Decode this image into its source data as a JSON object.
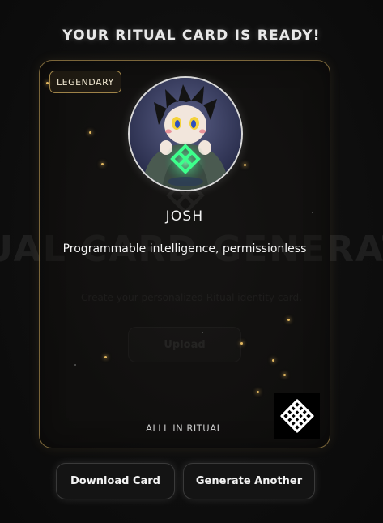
{
  "background": {
    "title": "RITUAL CARD GENERATOR",
    "subtitle": "Create your personalized Ritual identity card.",
    "upload_label": "Upload"
  },
  "headline": "YOUR RITUAL CARD IS READY!",
  "card": {
    "badge": "LEGENDARY",
    "name": "JOSH",
    "tagline": "Programmable intelligence, permissionless",
    "footer": "ALLL IN RITUAL",
    "logo_icon": "ritual-knot-icon",
    "avatar_icon": "avatar-illustration",
    "accent_color": "#d4af5f"
  },
  "actions": {
    "download_label": "Download Card",
    "generate_label": "Generate Another"
  }
}
